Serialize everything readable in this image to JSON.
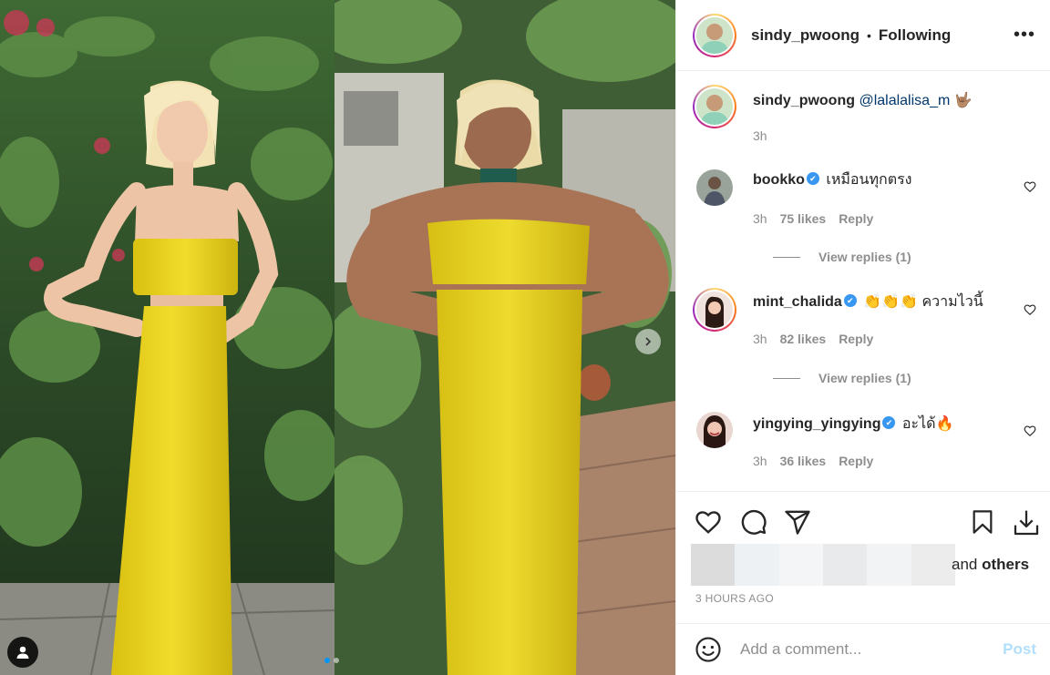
{
  "post": {
    "author": "sindy_pwoong",
    "separator": "•",
    "follow_status": "Following",
    "more_label": "•••"
  },
  "caption": {
    "username": "sindy_pwoong",
    "mention": "@lalalalisa_m",
    "emoji": "🤟🏽",
    "time": "3h"
  },
  "comments": [
    {
      "username": "bookko",
      "verified": true,
      "text": "เหมือนทุกตรง",
      "time": "3h",
      "likes": "75 likes",
      "reply": "Reply",
      "view_replies": "View replies (1)"
    },
    {
      "username": "mint_chalida",
      "verified": true,
      "text": "👏👏👏 ความไวนี้",
      "time": "3h",
      "likes": "82 likes",
      "reply": "Reply",
      "view_replies": "View replies (1)"
    },
    {
      "username": "yingying_yingying",
      "verified": true,
      "text": "อะได้🔥",
      "time": "3h",
      "likes": "36 likes",
      "reply": "Reply"
    }
  ],
  "likes_summary": {
    "prefix": "and ",
    "others": "others"
  },
  "timestamp": "3 HOURS AGO",
  "add_comment": {
    "placeholder": "Add a comment...",
    "post_label": "Post"
  },
  "colors": {
    "accent": "#0095f6",
    "post_disabled": "#b2dffc",
    "mention": "#00376b",
    "verified": "#3897f0",
    "dress_yellow": "#e8d21e"
  },
  "icons": [
    "user-tag-icon",
    "chevron-right-icon",
    "more-icon",
    "heart-icon",
    "comment-icon",
    "share-icon",
    "bookmark-icon",
    "download-icon",
    "emoji-icon",
    "verified-icon"
  ]
}
